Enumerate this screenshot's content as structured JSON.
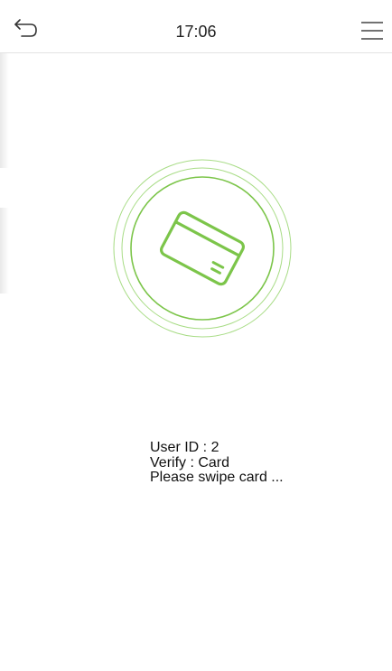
{
  "header": {
    "time": "17:06",
    "back_icon": "back-arrow-icon",
    "menu_icon": "hamburger-menu-icon"
  },
  "verify": {
    "illustration_icon": "card-icon",
    "user_id_line": "User ID : 2",
    "verify_line": "Verify : Card",
    "prompt_line": "Please swipe card ..."
  },
  "colors": {
    "accent_green": "#7cc54a",
    "ring_green": "#a8dc86",
    "text": "#111111",
    "divider": "#e3e3e3"
  }
}
